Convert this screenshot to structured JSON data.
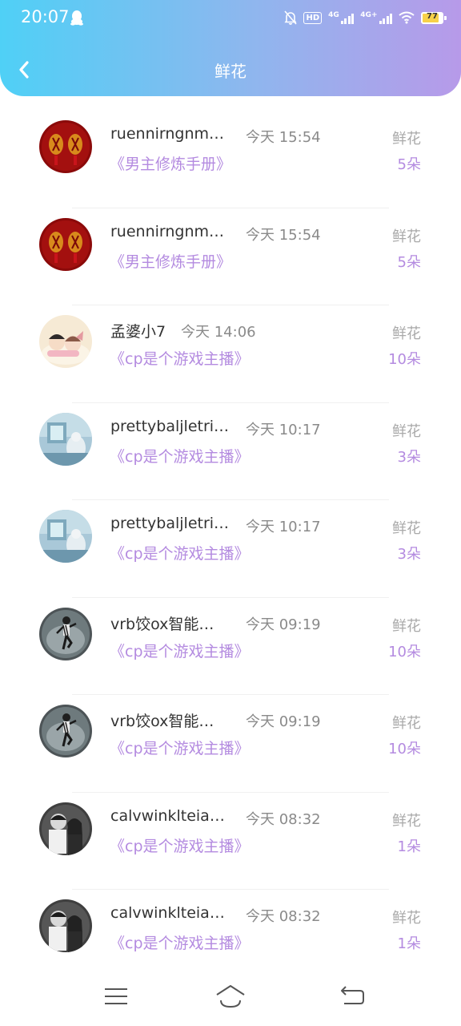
{
  "status_bar": {
    "time": "20:07",
    "hd": "HD",
    "net1": "4G",
    "net2": "4G+",
    "battery": "77"
  },
  "header": {
    "title": "鲜花",
    "back_icon": "chevron-left-icon"
  },
  "colors": {
    "gradient_start": "#4fd0f6",
    "gradient_end": "#b79ae9",
    "accent_purple": "#b48be0",
    "muted_gray": "#a9a9a9"
  },
  "records": [
    {
      "username": "ruennirngnm…",
      "time": "今天 15:54",
      "book": "《男主修炼手册》",
      "gift": "鲜花",
      "count": "5朵",
      "avatar": "red-lantern"
    },
    {
      "username": "ruennirngnm…",
      "time": "今天 15:54",
      "book": "《男主修炼手册》",
      "gift": "鲜花",
      "count": "5朵",
      "avatar": "red-lantern"
    },
    {
      "username": "孟婆小7",
      "time": "今天 14:06",
      "book": "《cp是个游戏主播》",
      "gift": "鲜花",
      "count": "10朵",
      "avatar": "cartoon-couple"
    },
    {
      "username": "prettybaljletri…",
      "time": "今天 10:17",
      "book": "《cp是个游戏主播》",
      "gift": "鲜花",
      "count": "3朵",
      "avatar": "blue-scene"
    },
    {
      "username": "prettybaljletri…",
      "time": "今天 10:17",
      "book": "《cp是个游戏主播》",
      "gift": "鲜花",
      "count": "3朵",
      "avatar": "blue-scene"
    },
    {
      "username": "vrb饺ox智能…",
      "time": "今天 09:19",
      "book": "《cp是个游戏主播》",
      "gift": "鲜花",
      "count": "10朵",
      "avatar": "dancer"
    },
    {
      "username": "vrb饺ox智能…",
      "time": "今天 09:19",
      "book": "《cp是个游戏主播》",
      "gift": "鲜花",
      "count": "10朵",
      "avatar": "dancer"
    },
    {
      "username": "calvwinklteia…",
      "time": "今天 08:32",
      "book": "《cp是个游戏主播》",
      "gift": "鲜花",
      "count": "1朵",
      "avatar": "bw-couple"
    },
    {
      "username": "calvwinklteia…",
      "time": "今天 08:32",
      "book": "《cp是个游戏主播》",
      "gift": "鲜花",
      "count": "1朵",
      "avatar": "bw-couple"
    }
  ],
  "bottom_nav": {
    "menu_icon": "menu-icon",
    "home_icon": "home-icon",
    "back_icon": "back-arrow-icon"
  }
}
